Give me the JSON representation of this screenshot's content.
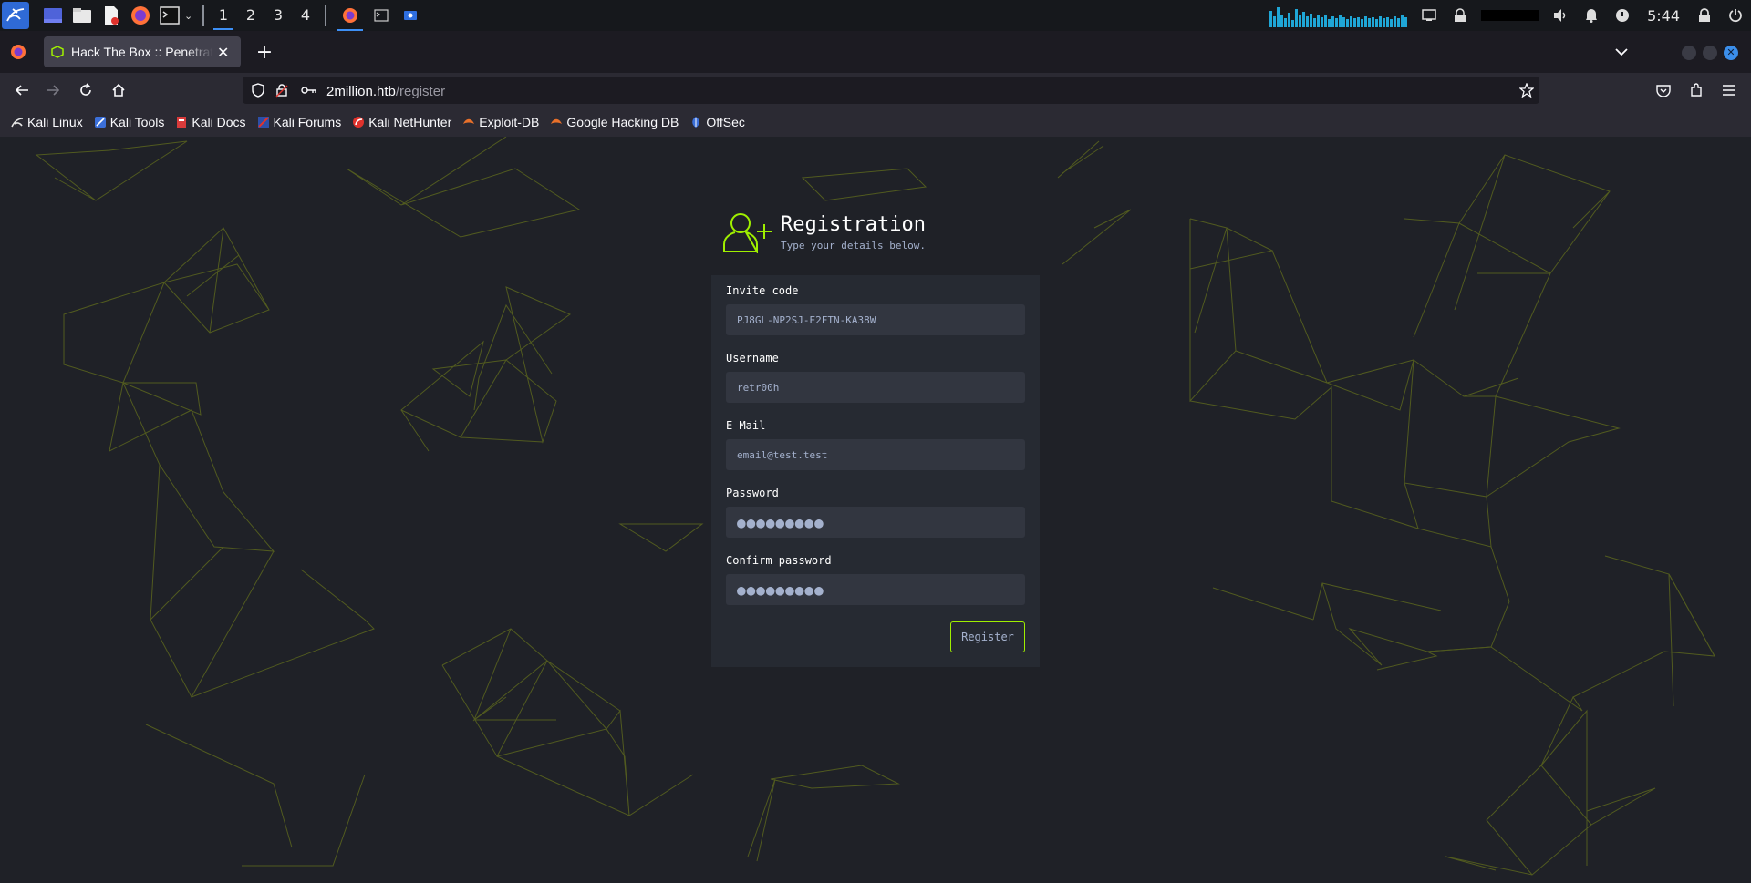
{
  "taskbar": {
    "workspaces": [
      "1",
      "2",
      "3",
      "4"
    ],
    "active_workspace": "1",
    "clock": "5:44"
  },
  "browser": {
    "tab_title": "Hack The Box :: Penetration Testing Labs",
    "url_host": "2million.htb",
    "url_path": "/register",
    "bookmarks": [
      "Kali Linux",
      "Kali Tools",
      "Kali Docs",
      "Kali Forums",
      "Kali NetHunter",
      "Exploit-DB",
      "Google Hacking DB",
      "OffSec"
    ]
  },
  "registration": {
    "title": "Registration",
    "subtitle": "Type your details below.",
    "invite_label": "Invite code",
    "invite_value": "PJ8GL-NP2SJ-E2FTN-KA38W",
    "username_label": "Username",
    "username_value": "retr00h",
    "email_label": "E-Mail",
    "email_value": "email@test.test",
    "password_label": "Password",
    "password_value": "●●●●●●●●●",
    "confirm_label": "Confirm password",
    "confirm_value": "●●●●●●●●●",
    "register_label": "Register"
  },
  "colors": {
    "accent": "#9fef00",
    "page_bg": "#1f2127",
    "card_bg": "#262a32",
    "field_bg": "#323640",
    "network_lines": "#5f6b1f"
  }
}
